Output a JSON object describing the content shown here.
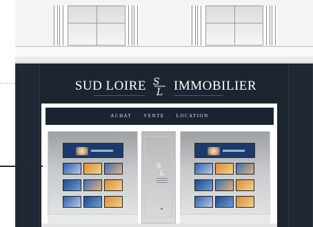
{
  "storefront": {
    "brand_left": "SUD LOIRE",
    "brand_right": "IMMOBILIER",
    "services": [
      "ACHAT",
      "VENTE",
      "LOCATION"
    ],
    "separator": "–"
  },
  "colors": {
    "fascia": "#1c2430",
    "accent": "#c62b2b",
    "facade": "#f4f4f4"
  },
  "icons": {
    "logo": "sl-monogram-logo"
  }
}
